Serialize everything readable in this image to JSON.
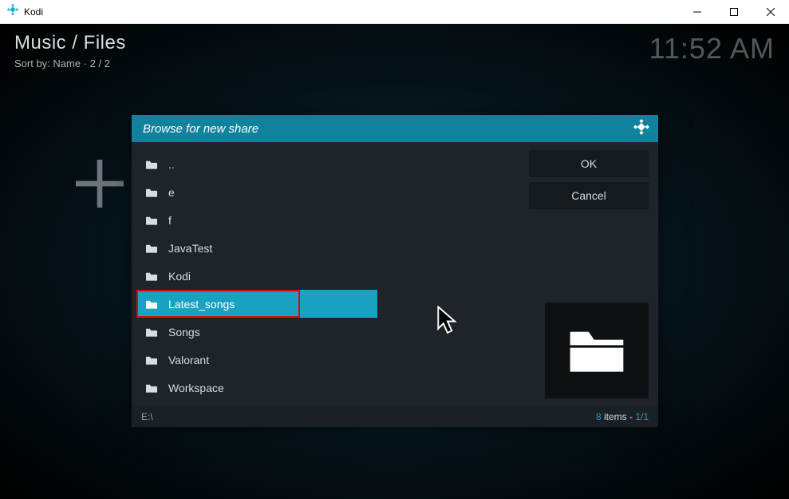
{
  "window": {
    "title": "Kodi"
  },
  "header": {
    "breadcrumb": "Music / Files",
    "sort_line": "Sort by: Name  ·  2 / 2",
    "clock": "11:52 AM"
  },
  "dialog": {
    "title": "Browse for new share",
    "items": [
      {
        "label": ".."
      },
      {
        "label": "e"
      },
      {
        "label": "f"
      },
      {
        "label": "JavaTest"
      },
      {
        "label": "Kodi"
      },
      {
        "label": "Latest_songs"
      },
      {
        "label": "Songs"
      },
      {
        "label": "Valorant"
      },
      {
        "label": "Workspace"
      }
    ],
    "selected_index": 5,
    "buttons": {
      "ok": "OK",
      "cancel": "Cancel"
    },
    "footer": {
      "path": "E:\\",
      "count_prefix": "8",
      "count_label": " items - ",
      "page": "1/1"
    }
  }
}
